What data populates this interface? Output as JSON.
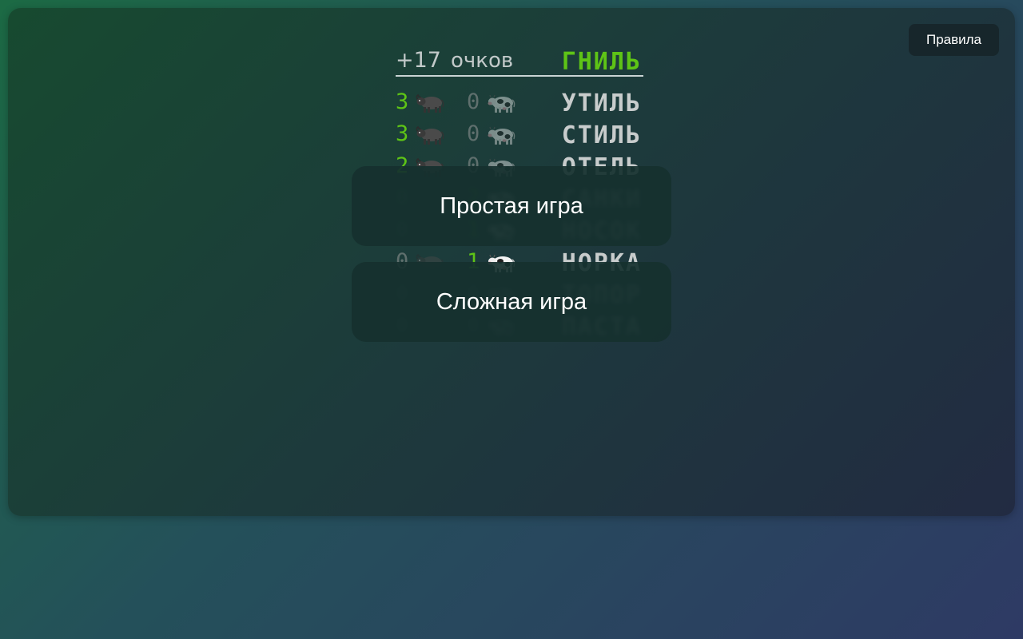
{
  "rules_label": "Правила",
  "score": {
    "value": "+17",
    "label": "очков"
  },
  "secret_word": "ГНИЛЬ",
  "guesses": [
    {
      "bulls": "3",
      "cows": "0",
      "word": "УТИЛЬ",
      "obscured": false
    },
    {
      "bulls": "3",
      "cows": "0",
      "word": "СТИЛЬ",
      "obscured": false
    },
    {
      "bulls": "2",
      "cows": "0",
      "word": "ОТЕЛЬ",
      "obscured": false
    },
    {
      "bulls": "0",
      "cows": "2",
      "word": "САНКИ",
      "obscured": true
    },
    {
      "bulls": "0",
      "cows": "1",
      "word": "НОСОК",
      "obscured": true
    },
    {
      "bulls": "0",
      "cows": "1",
      "word": "НОРКА",
      "obscured": false
    },
    {
      "bulls": "0",
      "cows": "0",
      "word": "ТОПОР",
      "obscured": true
    },
    {
      "bulls": "0",
      "cows": "0",
      "word": "ПАСТА",
      "obscured": true
    }
  ],
  "modes": {
    "easy_label": "Простая игра",
    "hard_label": "Сложная игра"
  },
  "icons": {
    "bull": "bull-icon",
    "cow": "cow-icon"
  },
  "colors": {
    "accent_green": "#5ec416",
    "muted_number": "#5f6f6d",
    "word_text": "#c8cccc",
    "button_bg": "#16302e"
  }
}
